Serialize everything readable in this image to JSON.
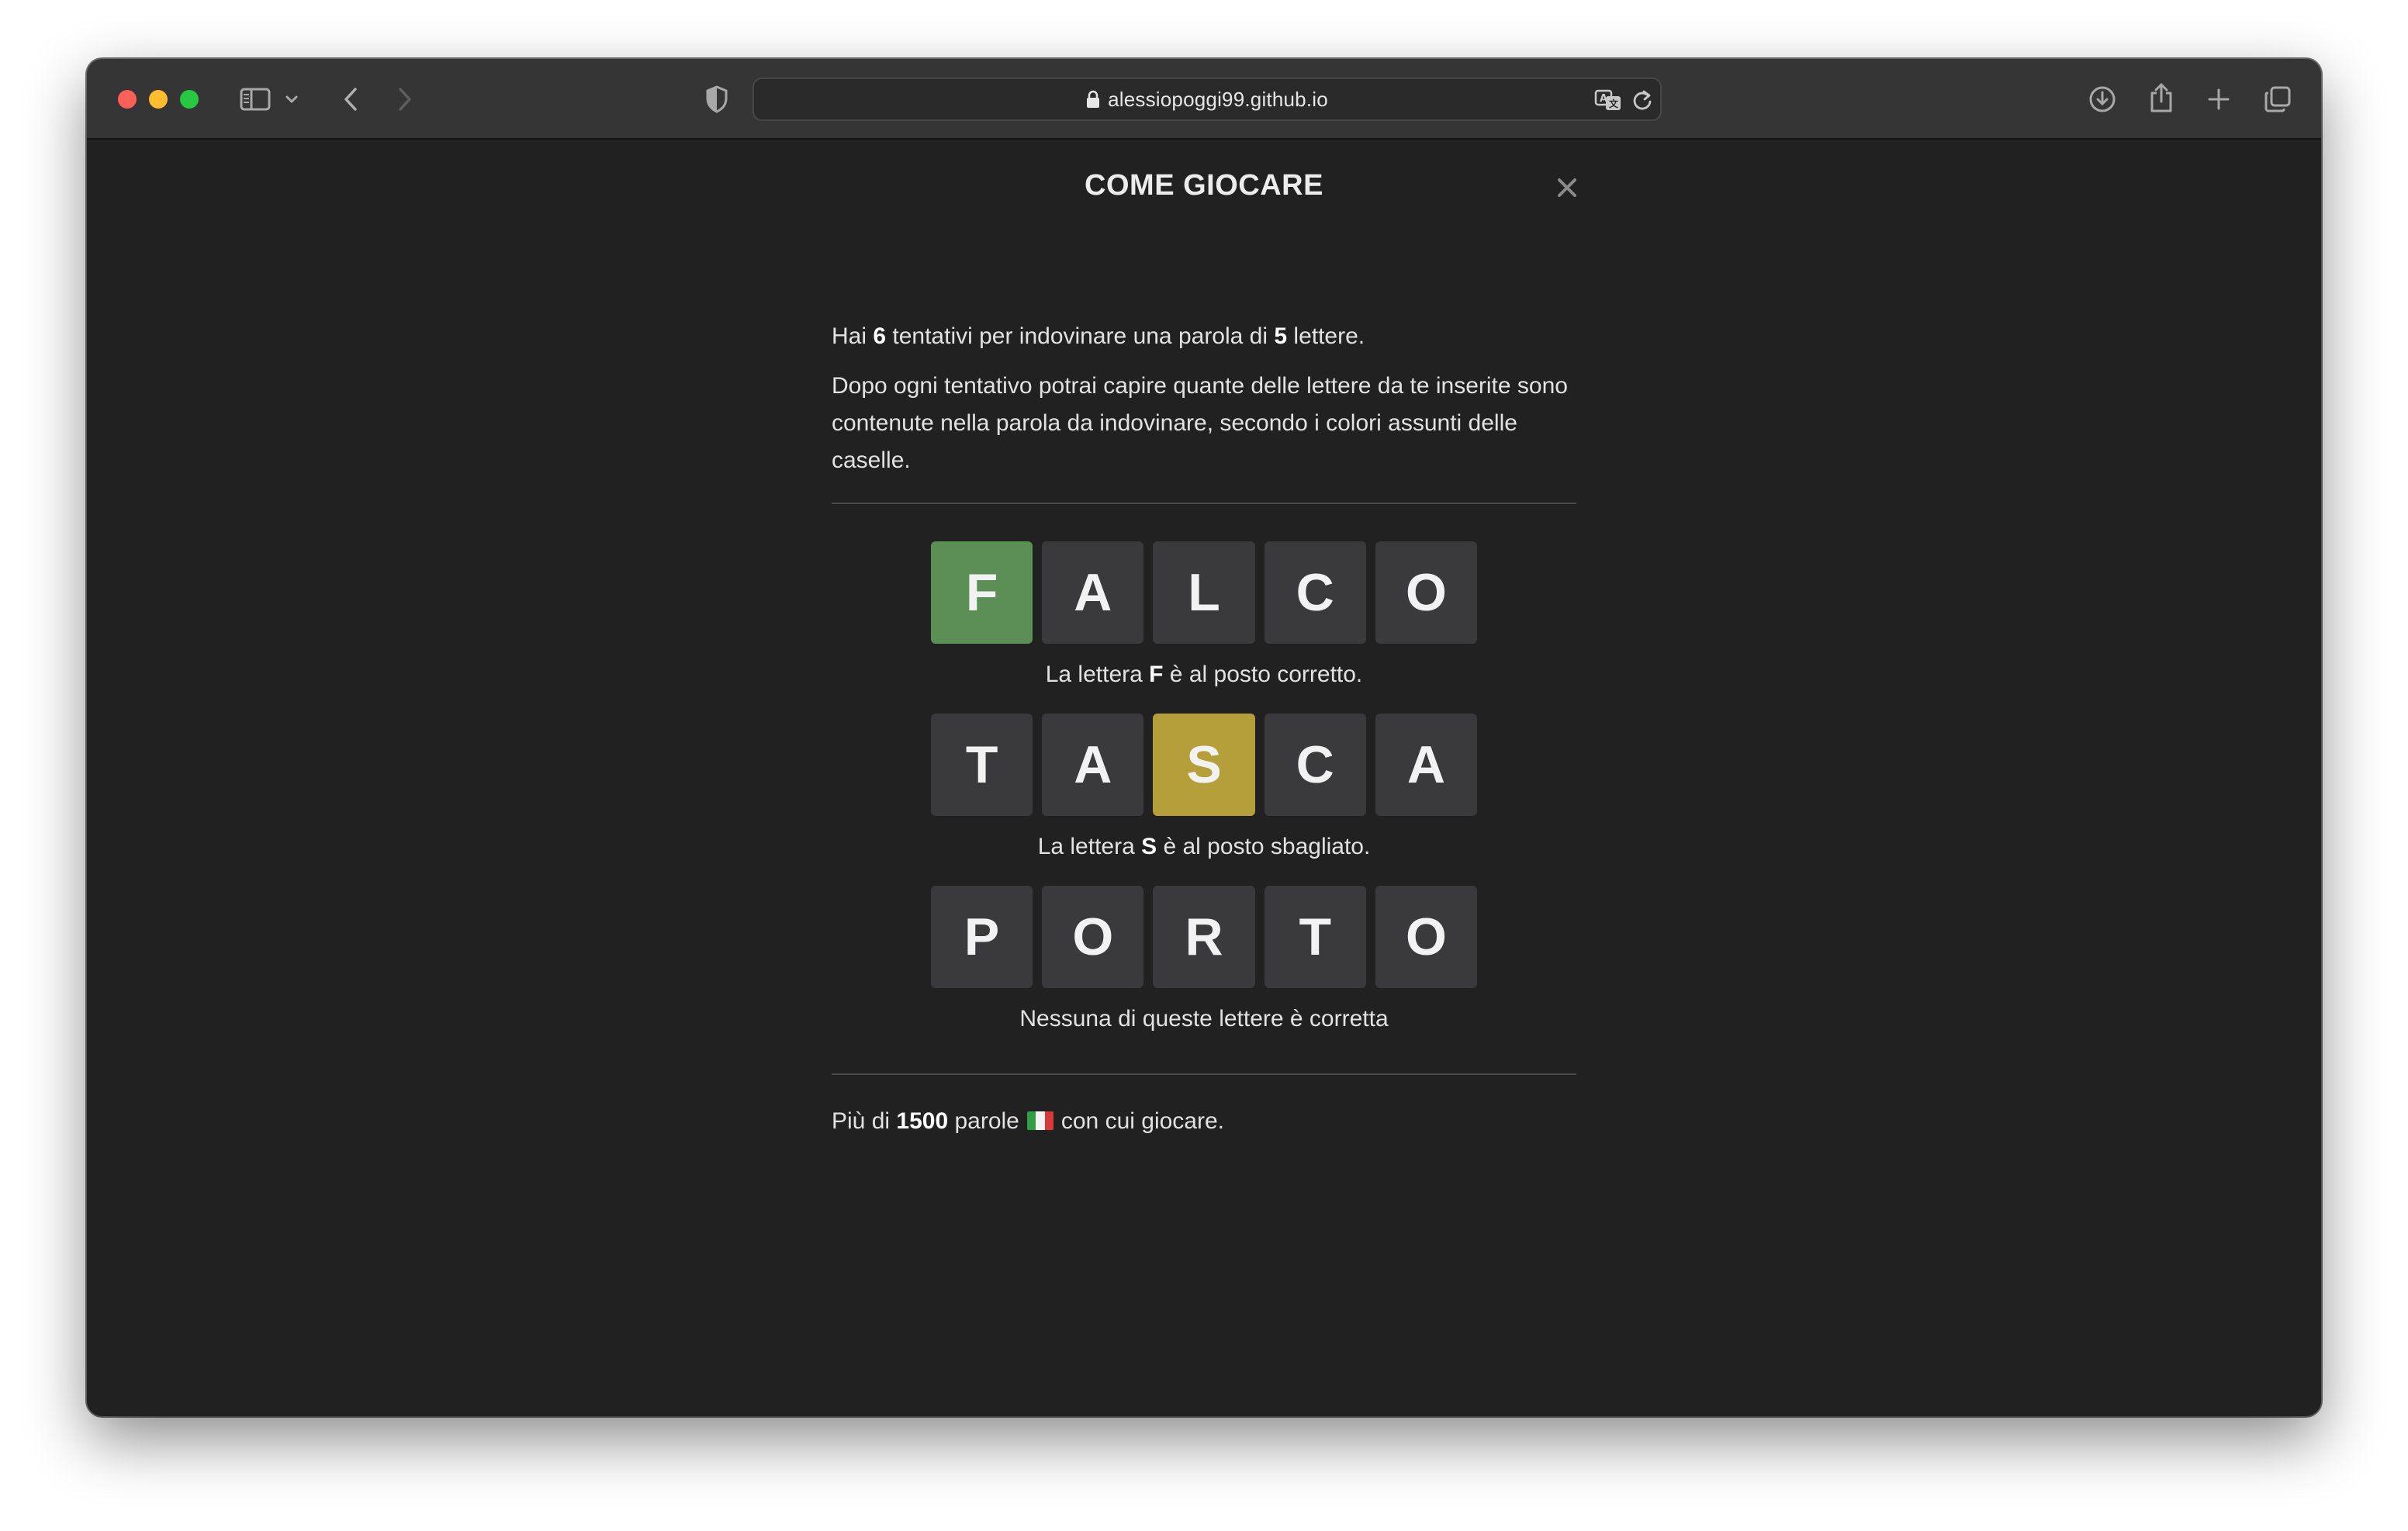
{
  "browser": {
    "url": "alessiopoggi99.github.io"
  },
  "modal": {
    "title": "COME GIOCARE",
    "close_label": "✕",
    "intro": {
      "part1": "Hai ",
      "attempts": "6",
      "part2": " tentativi per indovinare una parola di ",
      "letters": "5",
      "part3": " lettere."
    },
    "description": "Dopo ogni tentativo potrai capire quante delle lettere da te inserite sono contenute nella parola da indovinare, secondo i colori assunti delle caselle.",
    "examples": [
      {
        "word": "FALCO",
        "tiles": [
          {
            "letter": "F",
            "state": "correct"
          },
          {
            "letter": "A",
            "state": "absent"
          },
          {
            "letter": "L",
            "state": "absent"
          },
          {
            "letter": "C",
            "state": "absent"
          },
          {
            "letter": "O",
            "state": "absent"
          }
        ],
        "caption_pre": "La lettera ",
        "caption_letter": "F",
        "caption_post": " è al posto corretto."
      },
      {
        "word": "TASCA",
        "tiles": [
          {
            "letter": "T",
            "state": "absent"
          },
          {
            "letter": "A",
            "state": "absent"
          },
          {
            "letter": "S",
            "state": "present"
          },
          {
            "letter": "C",
            "state": "absent"
          },
          {
            "letter": "A",
            "state": "absent"
          }
        ],
        "caption_pre": "La lettera ",
        "caption_letter": "S",
        "caption_post": " è al posto sbagliato."
      },
      {
        "word": "PORTO",
        "tiles": [
          {
            "letter": "P",
            "state": "absent"
          },
          {
            "letter": "O",
            "state": "absent"
          },
          {
            "letter": "R",
            "state": "absent"
          },
          {
            "letter": "T",
            "state": "absent"
          },
          {
            "letter": "O",
            "state": "absent"
          }
        ],
        "caption": "Nessuna di queste lettere è corretta"
      }
    ],
    "footer": {
      "part1": "Più di ",
      "count": "1500",
      "part2": " parole",
      "flag_icon": "italy-flag-icon",
      "part3": "con cui giocare."
    }
  },
  "colors": {
    "correct": "#5c8f55",
    "present": "#b59f3b",
    "absent": "#3a3a3c",
    "background": "#212121"
  }
}
